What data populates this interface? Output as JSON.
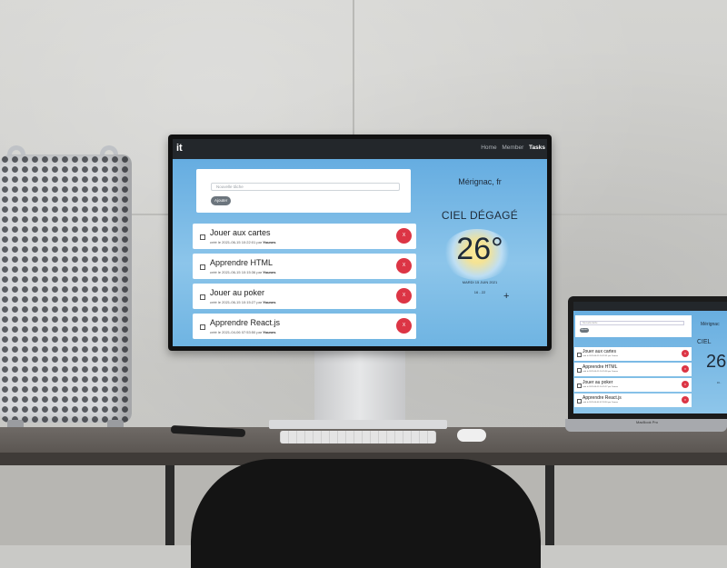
{
  "app": {
    "brand": "it",
    "nav": {
      "home": "Home",
      "member": "Member",
      "tasks": "Tasks"
    },
    "form": {
      "placeholder": "Nouvelle tâche",
      "add_label": "Ajouter"
    },
    "tasks": [
      {
        "title": "Jouer aux cartes",
        "meta_prefix": "créé le 2021-06-15 10:22:01 par",
        "author": "Younes",
        "delete_label": "X"
      },
      {
        "title": "Apprendre HTML",
        "meta_prefix": "créé le 2021-06-15 10:15:36 par",
        "author": "Younes",
        "delete_label": "X"
      },
      {
        "title": "Jouer au poker",
        "meta_prefix": "créé le 2021-06-15 10:15:27 par",
        "author": "Younes",
        "delete_label": "X"
      },
      {
        "title": "Apprendre React.js",
        "meta_prefix": "créé le 2021-04-06 07:53:50 par",
        "author": "Younes",
        "delete_label": "X"
      }
    ],
    "weather": {
      "city": "Mérignac, fr",
      "condition": "CIEL DÉGAGÉ",
      "temperature": "26°",
      "date": "MARDI 15 JUIN 2021",
      "range": "16 - 22",
      "add_symbol": "+"
    }
  },
  "laptop": {
    "city": "Mérignac",
    "condition": "CIEL",
    "temperature": "26",
    "range": "16 -",
    "brand": "MacBook Pro"
  },
  "colors": {
    "navbar": "#23272b",
    "sky": "#5ea8df",
    "delete": "#dc3545",
    "add_button": "#6c757d"
  }
}
